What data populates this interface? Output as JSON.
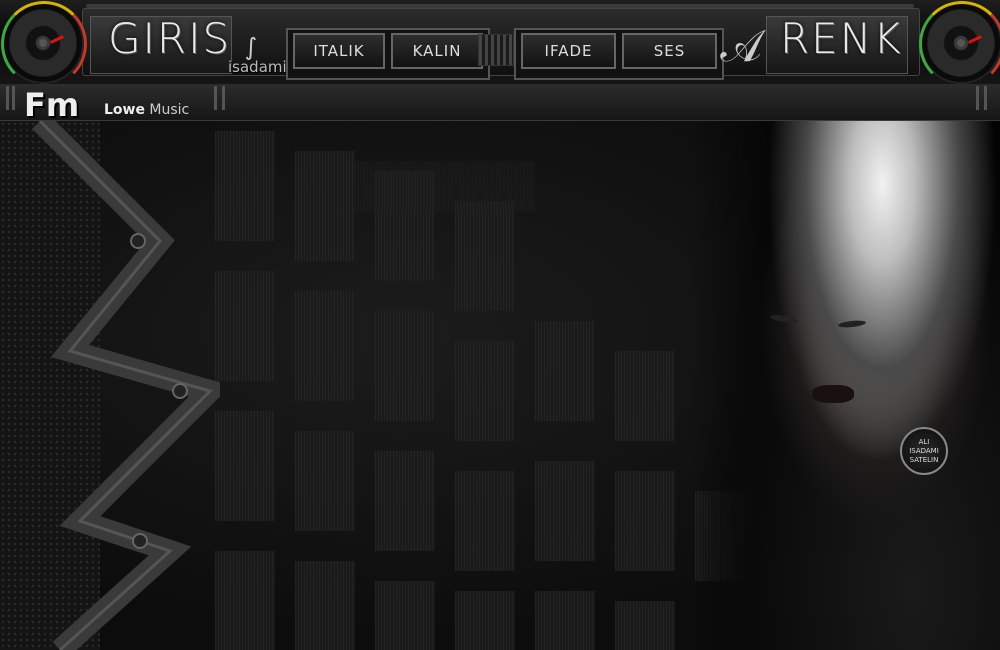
{
  "header": {
    "logo_left": "GIRIS",
    "logo_right": "RENK",
    "username": "isadami Ali",
    "buttons": [
      "ITALIK",
      "KALIN",
      "IFADE",
      "SES"
    ]
  },
  "subbar": {
    "fm_label": "Fm",
    "station_first": "Lowe",
    "station_second": "Music"
  },
  "badge": {
    "line1": "ALI",
    "line2": "ISADAMI",
    "line3": "SATELIN"
  },
  "colors": {
    "meter_green": "#3fa73f",
    "meter_yellow": "#d6b400",
    "meter_red": "#c0392b",
    "background": "#0c0c0c"
  },
  "icons": [
    "turntable-dial-icon",
    "swirl-ornament-icon"
  ]
}
